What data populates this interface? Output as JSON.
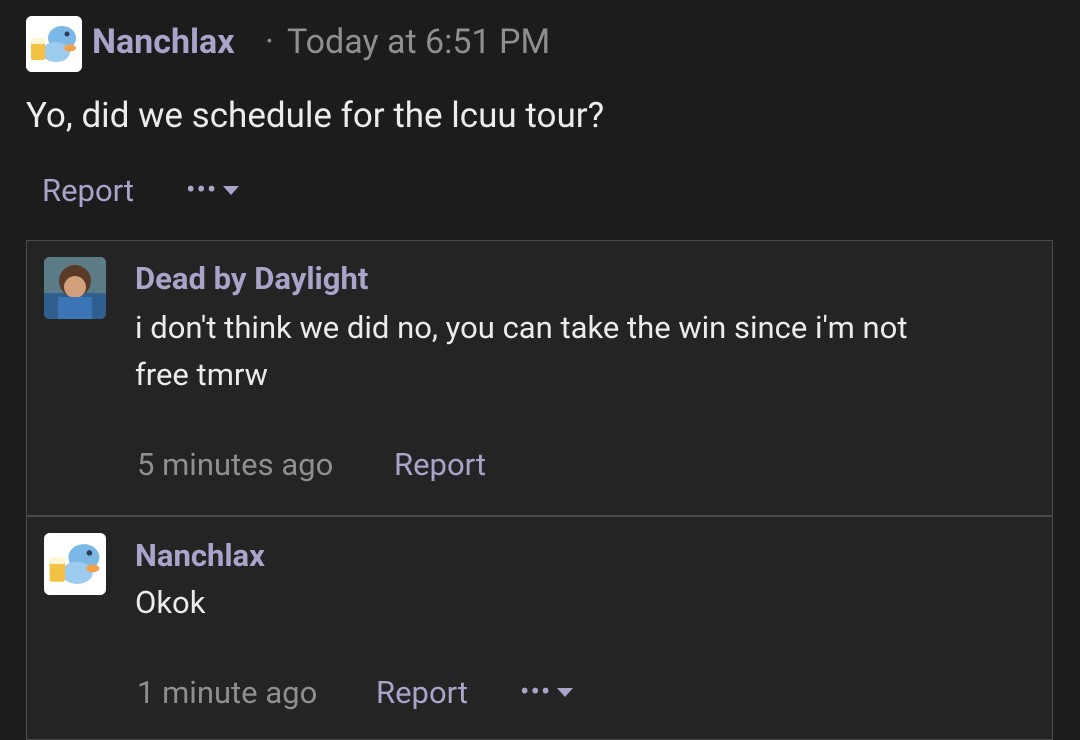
{
  "post": {
    "author": "Nanchlax",
    "sep": "·",
    "time": "Today at 6:51 PM",
    "message": "Yo, did we schedule for the lcuu tour?",
    "report_label": "Report",
    "more_icon": "ellipsis-caret-icon"
  },
  "replies": [
    {
      "author": "Dead by Daylight",
      "message_line1": "i don't think we did no, you can take the win since i'm not",
      "message_line2": "free tmrw",
      "time": "5 minutes ago",
      "report_label": "Report"
    },
    {
      "author": "Nanchlax",
      "message": "Okok",
      "time": "1 minute ago",
      "report_label": "Report",
      "more_icon": "ellipsis-caret-icon"
    }
  ],
  "colors": {
    "background": "#1c1c1c",
    "thread_bg": "#242424",
    "accent": "#a9a4c9",
    "muted": "#8f8f8f",
    "text": "#ececec"
  }
}
